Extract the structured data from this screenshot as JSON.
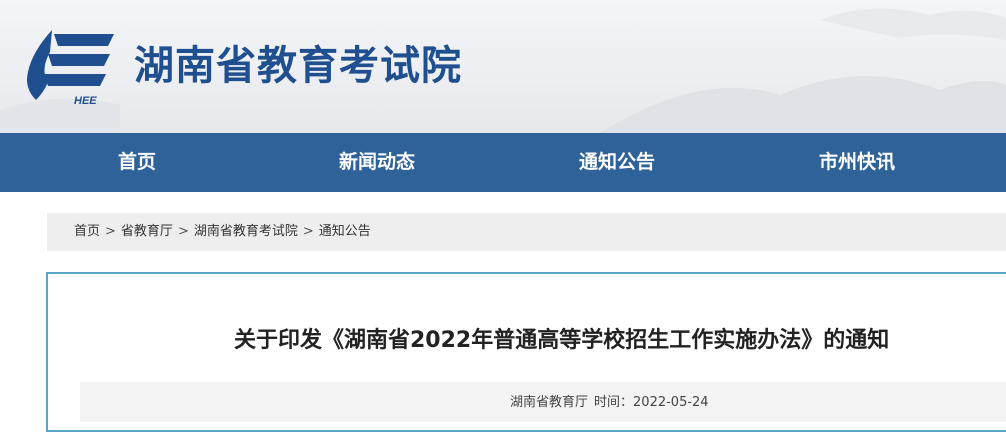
{
  "header": {
    "site_title": "湖南省教育考试院",
    "logo_text": "HEE"
  },
  "nav": {
    "items": [
      {
        "label": "首页"
      },
      {
        "label": "新闻动态"
      },
      {
        "label": "通知公告"
      },
      {
        "label": "市州快讯"
      }
    ]
  },
  "breadcrumb": {
    "items": [
      "首页",
      "省教育厅",
      "湖南省教育考试院",
      "通知公告"
    ],
    "separator": ">"
  },
  "article": {
    "title": "关于印发《湖南省2022年普通高等学校招生工作实施办法》的通知",
    "source": "湖南省教育厅",
    "date_label": "时间：",
    "date": "2022-05-24"
  },
  "colors": {
    "nav_bg": "#2f6299",
    "title_blue": "#1f4f8f",
    "article_border": "#58a7c9"
  }
}
